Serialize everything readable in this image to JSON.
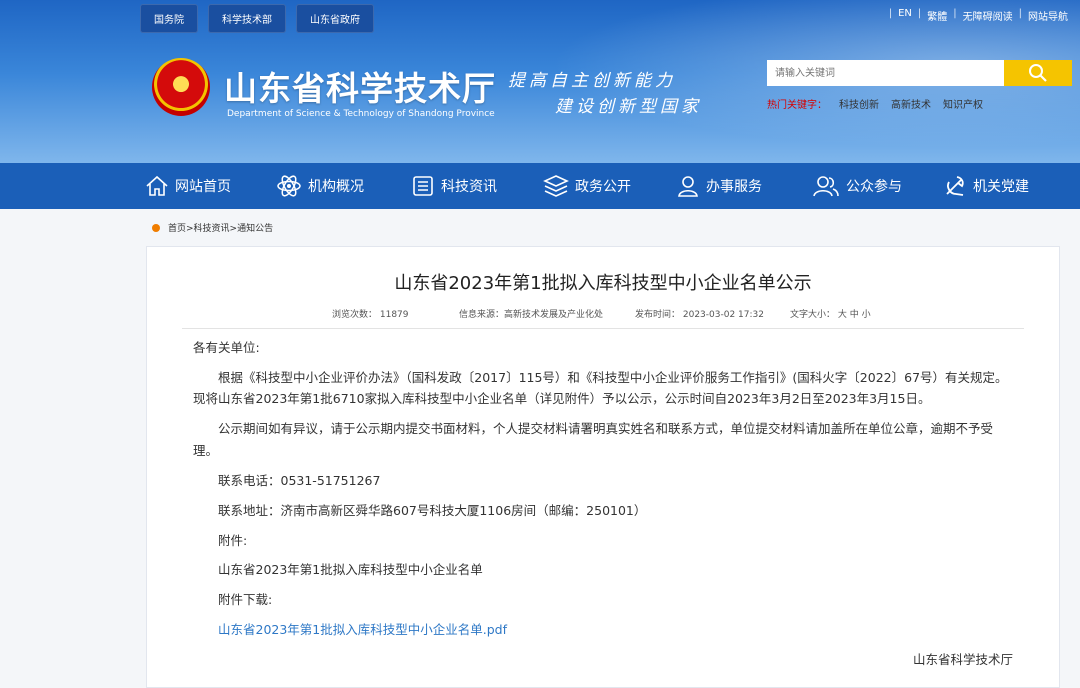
{
  "header": {
    "top_links": [
      "国务院",
      "科学技术部",
      "山东省政府"
    ],
    "right_links": [
      "EN",
      "繁體",
      "无障碍阅读",
      "网站导航"
    ],
    "site_title": "山东省科学技术厅",
    "site_subtitle": "Department of Science & Technology of Shandong Province",
    "slogan_line1": "提高自主创新能力",
    "slogan_line2": "建设创新型国家",
    "search": {
      "placeholder": "请输入关键词"
    },
    "hot": {
      "label": "热门关键字：",
      "keywords": [
        "科技创新",
        "高新技术",
        "知识产权"
      ]
    }
  },
  "nav": {
    "items": [
      {
        "label": "网站首页",
        "icon": "home-icon"
      },
      {
        "label": "机构概况",
        "icon": "atom-icon"
      },
      {
        "label": "科技资讯",
        "icon": "newspaper-icon"
      },
      {
        "label": "政务公开",
        "icon": "layers-icon"
      },
      {
        "label": "办事服务",
        "icon": "person-icon"
      },
      {
        "label": "公众参与",
        "icon": "people-icon"
      },
      {
        "label": "机关党建",
        "icon": "party-icon"
      }
    ]
  },
  "breadcrumb": "首页>科技资讯>通知公告",
  "article": {
    "title": "山东省2023年第1批拟入库科技型中小企业名单公示",
    "meta": {
      "views": "浏览次数： 11879",
      "source": "信息来源：高新技术发展及产业化处",
      "published": "发布时间： 2023-03-02 17:32",
      "font_size": "文字大小： 大 中 小"
    },
    "salutation": "各有关单位:",
    "para1_line1": "根据《科技型中小企业评价办法》（国科发政〔2017〕115号）和《科技型中小企业评价服务工作指引》(国科火字〔2022〕67号）有关规定。",
    "para1_line2": "现将山东省2023年第1批6710家拟入库科技型中小企业名单（详见附件）予以公示，公示时间自2023年3月2日至2023年3月15日。",
    "para2_line1": "公示期间如有异议，请于公示期内提交书面材料，个人提交材料请署明真实姓名和联系方式，单位提交材料请加盖所在单位公章，逾期不予受",
    "para2_line2": "理。",
    "phone": "联系电话：0531-51751267",
    "address": "联系地址：济南市高新区舜华路607号科技大厦1106房间（邮编：250101）",
    "attachment_label": "附件:",
    "attachment_name": "山东省2023年第1批拟入库科技型中小企业名单",
    "download_label": "附件下载:",
    "download_link": "山东省2023年第1批拟入库科技型中小企业名单.pdf",
    "signature": "山东省科学技术厅"
  }
}
